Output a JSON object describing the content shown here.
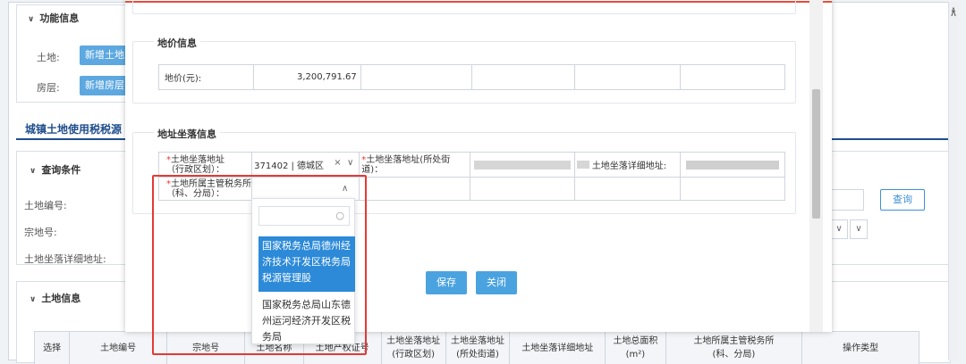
{
  "background": {
    "function_info": {
      "title": "功能信息",
      "land_label": "土地:",
      "land_button": "新增土地",
      "house_label": "房层:",
      "house_button": "新增房层"
    },
    "section_title": "城镇土地使用税税源",
    "query": {
      "title": "查询条件",
      "fields": [
        "土地编号:",
        "宗地号:",
        "土地坐落详细地址:"
      ],
      "query_button": "查询"
    },
    "land_info": {
      "title": "土地信息",
      "table_headers": [
        "选择",
        "土地编号",
        "宗地号",
        "土地名称",
        "土地产权证号",
        "土地坐落地址\n(行政区划)",
        "土地坐落地址\n(所处街道)",
        "土地坐落详细地址",
        "土地总面积\n(m²)",
        "土地所属主管税务所\n(科、分局)",
        "操作类型"
      ]
    }
  },
  "modal": {
    "land_price_section": {
      "legend": "地价信息",
      "price_label": "地价(元):",
      "price_value": "3,200,791.67"
    },
    "address_section": {
      "legend": "地址坐落信息",
      "admin_label": "土地坐落地址\n（行政区划）：",
      "admin_value": "371402 | 德城区",
      "street_label": "土地坐落地址(所处街道)：",
      "detail_label": "土地坐落详细地址:",
      "tax_office_label": "土地所属主管税务所\n（科、分局）：",
      "required_mark": "*"
    },
    "dropdown": {
      "search_placeholder": "",
      "options": [
        "国家税务总局德州经济技术开发区税务局税源管理股",
        "国家税务总局山东德州运河经济开发区税务局"
      ],
      "selected_index": 0
    },
    "buttons": {
      "save": "保存",
      "close": "关闭"
    }
  },
  "colors": {
    "primary": "#4aa3df",
    "selected": "#2c8ad8",
    "highlight": "#e53935",
    "section_title": "#1f4e8c"
  }
}
